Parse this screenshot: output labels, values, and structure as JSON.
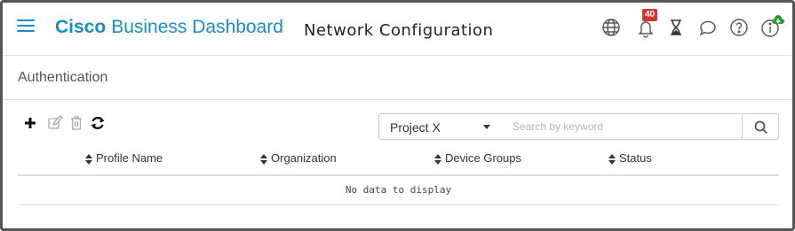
{
  "header": {
    "brand_bold": "Cisco",
    "brand_rest": "Business Dashboard",
    "title": "Network Configuration",
    "notifications_count": "40",
    "icons": [
      "hamburger-menu-icon",
      "globe-icon",
      "bell-icon",
      "hourglass-icon",
      "chat-icon",
      "help-icon",
      "info-icon",
      "download-badge-icon"
    ]
  },
  "section": {
    "title": "Authentication"
  },
  "toolbar": {
    "icons": [
      "add-icon",
      "edit-icon",
      "delete-icon",
      "refresh-icon"
    ],
    "project_selected": "Project X",
    "search_placeholder": "Search by keyword"
  },
  "table": {
    "columns": [
      "Profile Name",
      "Organization",
      "Device Groups",
      "Status"
    ],
    "rows": [],
    "empty_text": "No data to display"
  },
  "colors": {
    "brand": "#1a8cc6",
    "badge": "#d9342b",
    "download_badge": "#2e9c3f"
  }
}
